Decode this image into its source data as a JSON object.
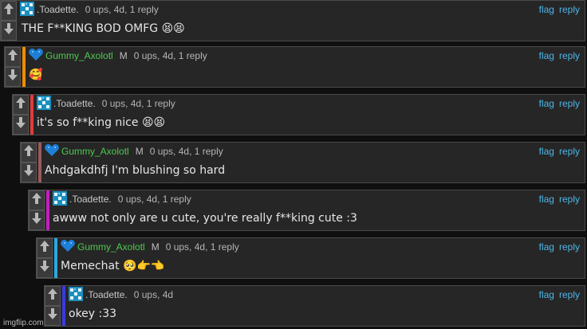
{
  "comments": [
    {
      "username": ".Toadette.",
      "mod": "",
      "meta": "0 ups, 4d, 1 reply",
      "text": "THE F**KING BOD OMFG 😫😫",
      "bar_color": "",
      "user_color": "grey",
      "avatar": "glitch-avatar-icon"
    },
    {
      "username": "Gummy_Axolotl",
      "mod": "M",
      "meta": "0 ups, 4d, 1 reply",
      "text": "🥰",
      "bar_color": "#f08c00",
      "user_color": "green",
      "avatar": "blue-heart-avatar-icon"
    },
    {
      "username": ".Toadette.",
      "mod": "",
      "meta": "0 ups, 4d, 1 reply",
      "text": "it's so f**king nice 😫😫",
      "bar_color": "#e03c3c",
      "user_color": "grey",
      "avatar": "glitch-avatar-icon"
    },
    {
      "username": "Gummy_Axolotl",
      "mod": "M",
      "meta": "0 ups, 4d, 1 reply",
      "text": "Ahdgakdhfj I'm blushing so hard",
      "bar_color": "#9a5a5a",
      "user_color": "green",
      "avatar": "blue-heart-avatar-icon"
    },
    {
      "username": ".Toadette.",
      "mod": "",
      "meta": "0 ups, 4d, 1 reply",
      "text": "awww not only are u cute, you're really f**king cute :3",
      "bar_color": "#c020c0",
      "user_color": "grey",
      "avatar": "glitch-avatar-icon"
    },
    {
      "username": "Gummy_Axolotl",
      "mod": "M",
      "meta": "0 ups, 4d, 1 reply",
      "text": "Memechat 🥺👉👈",
      "bar_color": "#2aa8e0",
      "user_color": "green",
      "avatar": "blue-heart-avatar-icon"
    },
    {
      "username": ".Toadette.",
      "mod": "",
      "meta": "0 ups, 4d",
      "text": "okey :33",
      "bar_color": "#3a3ae0",
      "user_color": "grey",
      "avatar": "glitch-avatar-icon"
    }
  ],
  "links": {
    "flag": "flag",
    "reply": "reply"
  },
  "watermark": "imgflip.com"
}
